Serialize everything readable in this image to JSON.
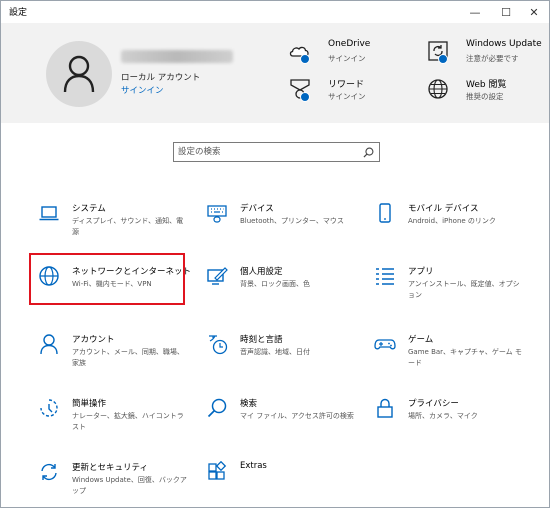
{
  "window": {
    "title": "設定",
    "minimize_symbol": "—",
    "maximize_symbol": "☐",
    "close_symbol": "✕"
  },
  "account": {
    "username": "",
    "account_type": "ローカル アカウント",
    "sign_in": "サインイン"
  },
  "header_items": [
    {
      "title": "OneDrive",
      "subtitle": "サインイン",
      "icon": "onedrive-icon"
    },
    {
      "title": "Windows Update",
      "subtitle": "注意が必要です",
      "icon": "windows-update-icon"
    },
    {
      "title": "リワード",
      "subtitle": "サインイン",
      "icon": "rewards-icon"
    },
    {
      "title": "Web 閲覧",
      "subtitle": "推奨の設定",
      "icon": "globe-icon"
    }
  ],
  "search": {
    "placeholder": "設定の検索"
  },
  "tiles": [
    {
      "name": "システム",
      "desc": "ディスプレイ、サウンド、通知、電源",
      "icon": "laptop-icon"
    },
    {
      "name": "デバイス",
      "desc": "Bluetooth、プリンター、マウス",
      "icon": "keyboard-icon"
    },
    {
      "name": "モバイル デバイス",
      "desc": "Android、iPhone のリンク",
      "icon": "phone-icon"
    },
    {
      "name": "ネットワークとインターネット",
      "desc": "Wi-Fi、機内モード、VPN",
      "icon": "globe-icon"
    },
    {
      "name": "個人用設定",
      "desc": "背景、ロック画面、色",
      "icon": "personalization-icon"
    },
    {
      "name": "アプリ",
      "desc": "アンインストール、既定値、オプション",
      "icon": "apps-list-icon"
    },
    {
      "name": "アカウント",
      "desc": "アカウント、メール、同期、職場、家族",
      "icon": "person-icon"
    },
    {
      "name": "時刻と言語",
      "desc": "音声認識、地域、日付",
      "icon": "time-language-icon"
    },
    {
      "name": "ゲーム",
      "desc": "Game Bar、キャプチャ、ゲーム モード",
      "icon": "gamepad-icon"
    },
    {
      "name": "簡単操作",
      "desc": "ナレーター、拡大鏡、ハイコントラスト",
      "icon": "ease-of-access-icon"
    },
    {
      "name": "検索",
      "desc": "マイ ファイル、アクセス許可の検索",
      "icon": "search-icon"
    },
    {
      "name": "プライバシー",
      "desc": "場所、カメラ、マイク",
      "icon": "lock-icon"
    },
    {
      "name": "更新とセキュリティ",
      "desc": "Windows Update、回復、バックアップ",
      "icon": "sync-icon"
    },
    {
      "name": "Extras",
      "desc": "",
      "icon": "extras-icon"
    }
  ],
  "colors": {
    "accent": "#0067c0",
    "highlight_border": "#e0141f",
    "header_bg": "#f2f2f2"
  }
}
